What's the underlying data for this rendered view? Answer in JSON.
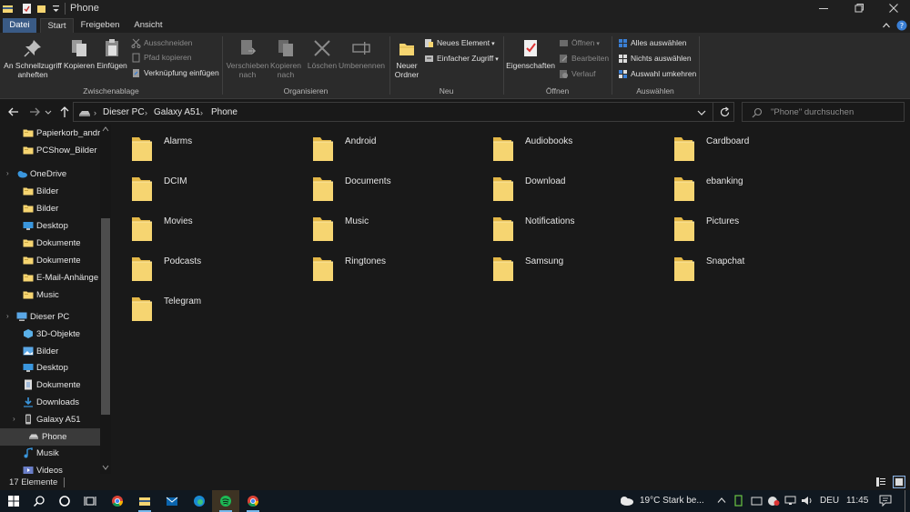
{
  "window": {
    "title": "Phone"
  },
  "tabs": {
    "file": "Datei",
    "start": "Start",
    "share": "Freigeben",
    "view": "Ansicht"
  },
  "ribbon": {
    "pin_label_1": "An Schnellzugriff",
    "pin_label_2": "anheften",
    "copy": "Kopieren",
    "paste": "Einfügen",
    "cut": "Ausschneiden",
    "copy_path": "Pfad kopieren",
    "paste_shortcut": "Verknüpfung einfügen",
    "group_clipboard": "Zwischenablage",
    "move_1": "Verschieben",
    "move_2": "nach",
    "copyto_1": "Kopieren",
    "copyto_2": "nach",
    "delete": "Löschen",
    "rename": "Umbenennen",
    "group_organize": "Organisieren",
    "new_folder_1": "Neuer",
    "new_folder_2": "Ordner",
    "new_item": "Neues Element",
    "easy_access": "Einfacher Zugriff",
    "group_new": "Neu",
    "properties": "Eigenschaften",
    "open": "Öffnen",
    "edit": "Bearbeiten",
    "history": "Verlauf",
    "group_open": "Öffnen",
    "select_all": "Alles auswählen",
    "select_none": "Nichts auswählen",
    "invert_selection": "Auswahl umkehren",
    "group_select": "Auswählen"
  },
  "address": {
    "crumbs": [
      "Dieser PC",
      "Galaxy A51",
      "Phone"
    ],
    "search_placeholder": "\"Phone\" durchsuchen"
  },
  "sidebar": {
    "items": [
      {
        "label": "Papierkorb_andre",
        "icon": "folder-icon"
      },
      {
        "label": "PCShow_Bilder",
        "icon": "folder-icon"
      },
      {
        "label": "OneDrive",
        "icon": "cloud-icon"
      },
      {
        "label": "Bilder",
        "icon": "folder-icon"
      },
      {
        "label": "Bilder",
        "icon": "folder-icon"
      },
      {
        "label": "Desktop",
        "icon": "desktop-icon"
      },
      {
        "label": "Dokumente",
        "icon": "folder-icon"
      },
      {
        "label": "Dokumente",
        "icon": "folder-icon"
      },
      {
        "label": "E-Mail-Anhänge",
        "icon": "folder-icon"
      },
      {
        "label": "Music",
        "icon": "folder-icon"
      },
      {
        "label": "Dieser PC",
        "icon": "pc-icon"
      },
      {
        "label": "3D-Objekte",
        "icon": "cube-icon"
      },
      {
        "label": "Bilder",
        "icon": "pictures-icon"
      },
      {
        "label": "Desktop",
        "icon": "desktop-icon"
      },
      {
        "label": "Dokumente",
        "icon": "documents-icon"
      },
      {
        "label": "Downloads",
        "icon": "download-icon"
      },
      {
        "label": "Galaxy A51",
        "icon": "phone-icon"
      },
      {
        "label": "Phone",
        "icon": "drive-icon"
      },
      {
        "label": "Musik",
        "icon": "music-icon"
      },
      {
        "label": "Videos",
        "icon": "video-icon"
      }
    ]
  },
  "folders": [
    "Alarms",
    "Android",
    "Audiobooks",
    "Cardboard",
    "DCIM",
    "Documents",
    "Download",
    "ebanking",
    "Movies",
    "Music",
    "Notifications",
    "Pictures",
    "Podcasts",
    "Ringtones",
    "Samsung",
    "Snapchat",
    "Telegram"
  ],
  "status": {
    "count": "17 Elemente"
  },
  "taskbar": {
    "weather": "19°C  Stark be...",
    "language": "DEU",
    "time": "11:45"
  },
  "colors": {
    "folder": "#f6d571",
    "accent": "#76b9ed",
    "file_tab": "#3a5b86"
  }
}
